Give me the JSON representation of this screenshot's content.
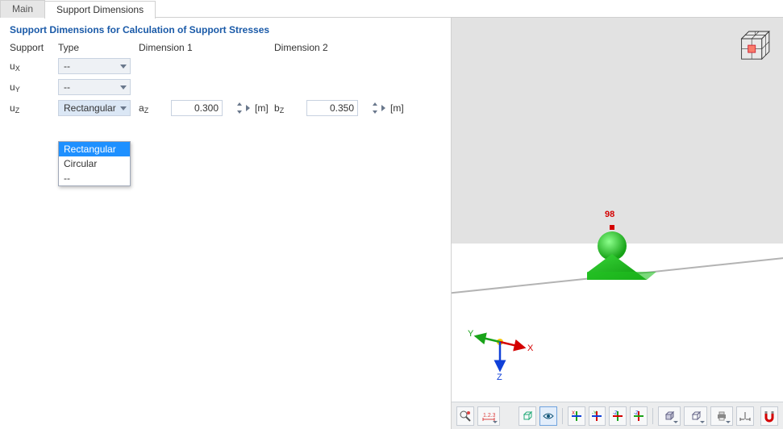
{
  "tabs": {
    "main": "Main",
    "supportDims": "Support Dimensions"
  },
  "section_title": "Support Dimensions for Calculation of Support Stresses",
  "headers": {
    "support": "Support",
    "type": "Type",
    "dim1": "Dimension 1",
    "dim2": "Dimension 2"
  },
  "rows": {
    "ux": {
      "label_pre": "u",
      "label_sub": "X",
      "type": "--"
    },
    "uy": {
      "label_pre": "u",
      "label_sub": "Y",
      "type": "--"
    },
    "uz": {
      "label_pre": "u",
      "label_sub": "Z",
      "type": "Rectangular",
      "d1_label_pre": "a",
      "d1_label_sub": "Z",
      "d1_value": "0.300",
      "d1_unit": "[m]",
      "d2_label_pre": "b",
      "d2_label_sub": "Z",
      "d2_value": "0.350",
      "d2_unit": "[m]"
    }
  },
  "dropdown": {
    "opt1": "Rectangular",
    "opt2": "Circular",
    "opt3": "--"
  },
  "viewport": {
    "node_label": "98",
    "axes": {
      "x": "X",
      "y": "Y",
      "z": "Z"
    }
  },
  "toolbar_icons": [
    "magnify-node-icon",
    "dimension-icon",
    "view-cube-icon",
    "view-eyepoint-icon",
    "axis-x-icon",
    "axis-y-icon",
    "axis-xz-icon",
    "axis-yz-icon",
    "render-normal-icon",
    "render-wire-icon",
    "print-icon",
    "scale-icon",
    "home-magnet-icon"
  ]
}
